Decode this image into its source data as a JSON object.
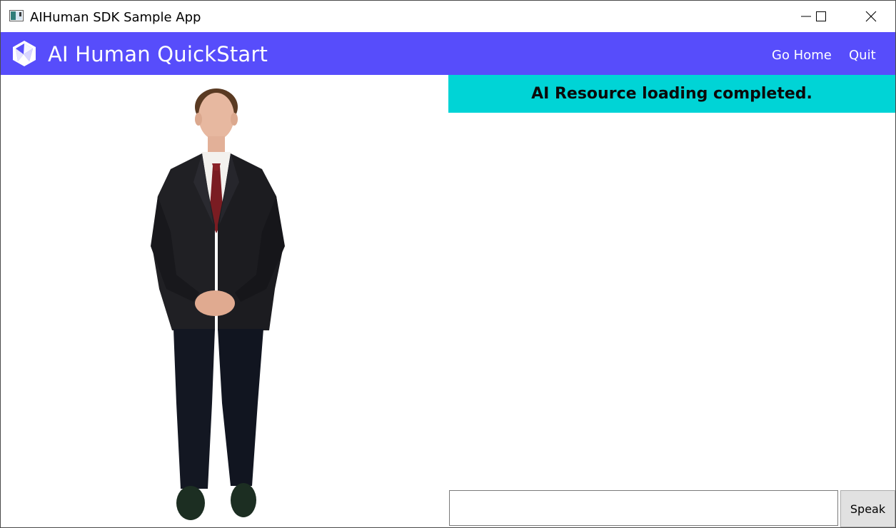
{
  "window": {
    "title": "AIHuman SDK Sample App"
  },
  "header": {
    "app_title": "AI Human QuickStart",
    "logo_icon": "cube-logo-icon",
    "nav": {
      "home_label": "Go Home",
      "quit_label": "Quit"
    }
  },
  "status": {
    "message": "AI Resource loading completed."
  },
  "input": {
    "value": "",
    "placeholder": ""
  },
  "actions": {
    "speak_label": "Speak"
  },
  "colors": {
    "header_bg": "#574dfb",
    "status_bg": "#00d4d6"
  }
}
